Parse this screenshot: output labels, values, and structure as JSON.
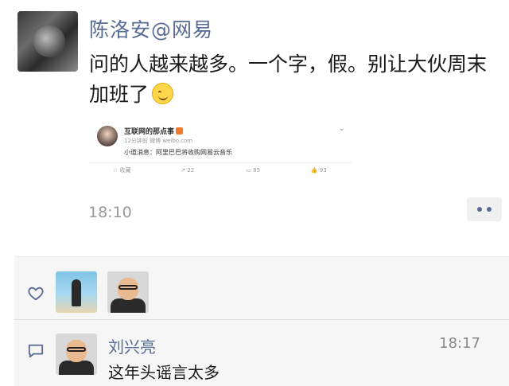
{
  "post": {
    "author": "陈洛安@网易",
    "text": "问的人越来越多。一个字，假。别让大伙周末加班了",
    "emoji": "smiley-emoji",
    "time": "18:10",
    "shared": {
      "name": "互联网的那点事",
      "meta": "12分钟前 微博 weibo.com",
      "body": "小道消息：阿里巴巴将收购网易云音乐",
      "actions": [
        "收藏",
        "22",
        "85",
        "93"
      ]
    }
  },
  "comments": [
    {
      "name": "刘兴亮",
      "time": "18:17",
      "text": "这年头谣言太多"
    }
  ],
  "colors": {
    "name_link": "#576b95",
    "comment_bg": "#f6f6f6"
  }
}
